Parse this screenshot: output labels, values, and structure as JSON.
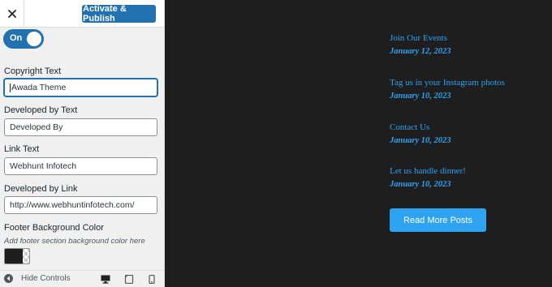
{
  "header": {
    "publish_label": "Activate & Publish"
  },
  "toggle": {
    "label": "On"
  },
  "fields": [
    {
      "label": "Copyright Text",
      "value": "Awada Theme"
    },
    {
      "label": "Developed by Text",
      "value": "Developed By"
    },
    {
      "label": "Link Text",
      "value": "Webhunt Infotech"
    },
    {
      "label": "Developed by Link",
      "value": "http://www.webhuntinfotech.com/"
    }
  ],
  "footer_bg": {
    "label": "Footer Background Color",
    "description": "Add footer section background color here",
    "color": "#1e1e1e"
  },
  "footer": {
    "hide_controls": "Hide Controls",
    "devices": [
      "desktop-icon",
      "tablet-icon",
      "mobile-icon"
    ]
  },
  "posts": [
    {
      "title": "Join Our Events",
      "date": "January 12, 2023"
    },
    {
      "title": "Tag us in your Instagram photos",
      "date": "January 10, 2023"
    },
    {
      "title": "Contact Us",
      "date": "January 10, 2023"
    },
    {
      "title": "Let us handle dinner!",
      "date": "January 10, 2023"
    }
  ],
  "more_button": {
    "label": "Read More Posts"
  },
  "colors": {
    "accent": "#2271b1",
    "link": "#2ea3f2",
    "button": "#2ea3f2",
    "preview_bg": "#1e1e1e"
  }
}
